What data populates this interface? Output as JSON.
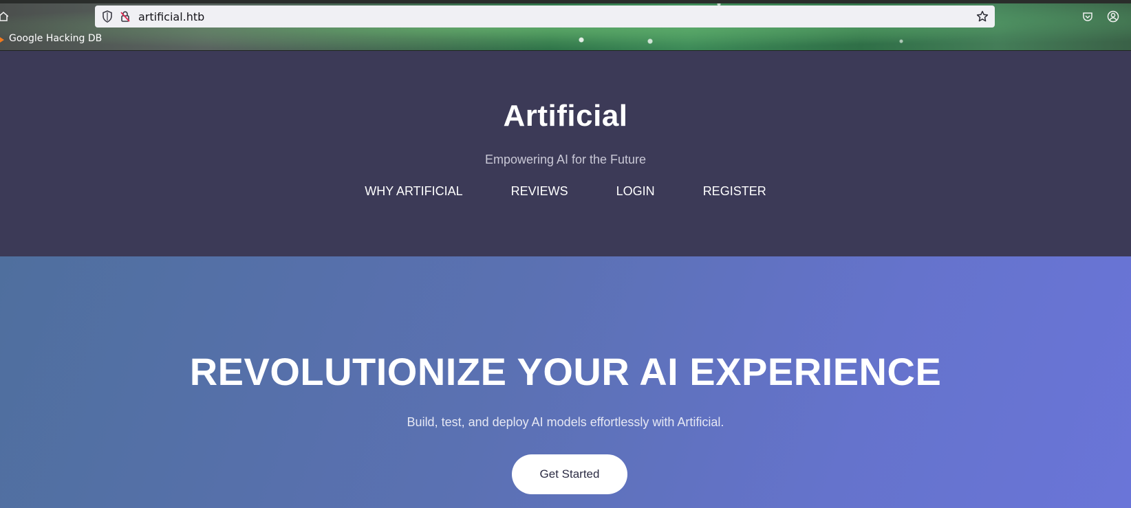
{
  "browser": {
    "url": "artificial.htb",
    "bookmarks": [
      {
        "label": "Google Hacking DB"
      }
    ]
  },
  "site": {
    "brand": "Artificial",
    "tagline": "Empowering AI for the Future",
    "nav": [
      {
        "label": "WHY ARTIFICIAL"
      },
      {
        "label": "REVIEWS"
      },
      {
        "label": "LOGIN"
      },
      {
        "label": "REGISTER"
      }
    ]
  },
  "hero": {
    "title": "REVOLUTIONIZE YOUR AI EXPERIENCE",
    "subtitle": "Build, test, and deploy AI models effortlessly with Artificial.",
    "cta_label": "Get Started"
  },
  "colors": {
    "header_bg": "#3c3a57",
    "hero_gradient_start": "#4f6f9e",
    "hero_gradient_end": "#6a75d8",
    "cta_bg": "#ffffff"
  }
}
